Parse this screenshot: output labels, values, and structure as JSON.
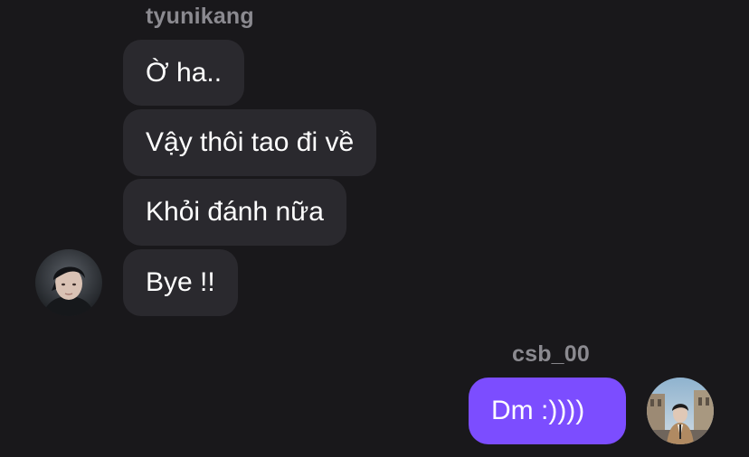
{
  "conversation": {
    "incoming": {
      "sender_name": "tyunikang",
      "avatar_icon": "user-avatar-icon",
      "messages": [
        {
          "text": "Ờ ha.."
        },
        {
          "text": "Vậy thôi tao đi về"
        },
        {
          "text": "Khỏi đánh nữa"
        },
        {
          "text": "Bye !!"
        }
      ]
    },
    "outgoing": {
      "sender_name": "csb_00",
      "avatar_icon": "user-avatar-icon",
      "messages": [
        {
          "text": "Dm :))))"
        }
      ]
    }
  },
  "colors": {
    "background": "#19181b",
    "incoming_bubble": "#2a292e",
    "outgoing_bubble": "#7c4dff",
    "sender_name": "#8b8a90"
  }
}
